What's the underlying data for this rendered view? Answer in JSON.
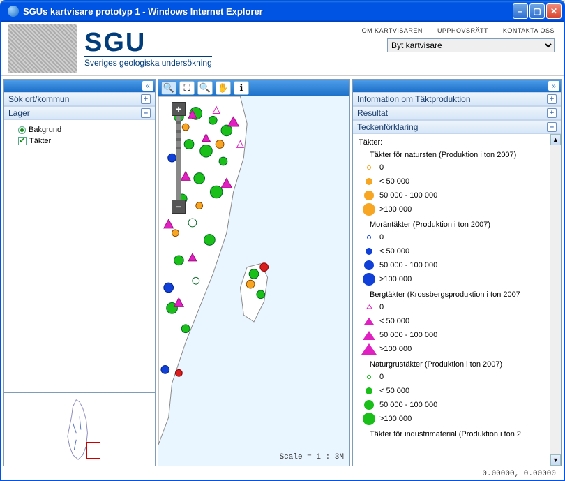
{
  "window": {
    "title": "SGUs kartvisare prototyp 1 - Windows Internet Explorer"
  },
  "logo": {
    "main": "SGU",
    "sub": "Sveriges geologiska undersökning"
  },
  "header_links": {
    "about": "OM KARTVISAREN",
    "copyright": "UPPHOVSRÄTT",
    "contact": "KONTAKTA OSS"
  },
  "selector": {
    "selected": "Byt kartvisare"
  },
  "left": {
    "search_title": "Sök ort/kommun",
    "layers_title": "Lager",
    "layers": [
      {
        "type": "radio",
        "checked": true,
        "label": "Bakgrund"
      },
      {
        "type": "check",
        "checked": true,
        "label": "Täkter"
      }
    ]
  },
  "map": {
    "scale": "Scale = 1 : 3M"
  },
  "right": {
    "info_title": "Information om Täktproduktion",
    "result_title": "Resultat",
    "legend_title": "Teckenförklaring",
    "legend_header": "Täkter:",
    "groups": [
      {
        "title": "Täkter för natursten (Produktion i ton 2007)",
        "shape": "circle",
        "fill_base": "#f6a623",
        "items": [
          {
            "label": "0",
            "size": 6,
            "fill": "none"
          },
          {
            "label": "< 50 000",
            "size": 10,
            "fill": "#f6a623"
          },
          {
            "label": "50 000 - 100 000",
            "size": 14,
            "fill": "#f6a623"
          },
          {
            "label": ">100 000",
            "size": 18,
            "fill": "#f6a623"
          }
        ]
      },
      {
        "title": "Moräntäkter (Produktion i ton 2007)",
        "shape": "circle",
        "fill_base": "#1040d8",
        "items": [
          {
            "label": "0",
            "size": 6,
            "fill": "none"
          },
          {
            "label": "< 50 000",
            "size": 10,
            "fill": "#1040d8"
          },
          {
            "label": "50 000 - 100 000",
            "size": 14,
            "fill": "#1040d8"
          },
          {
            "label": ">100 000",
            "size": 18,
            "fill": "#1040d8"
          }
        ]
      },
      {
        "title": "Bergtäkter (Krossbergsproduktion i ton 2007",
        "shape": "triangle",
        "fill_base": "#e020c0",
        "items": [
          {
            "label": "0",
            "size": 6,
            "fill": "none"
          },
          {
            "label": "< 50 000",
            "size": 10,
            "fill": "#e020c0"
          },
          {
            "label": "50 000 - 100 000",
            "size": 13,
            "fill": "#e020c0"
          },
          {
            "label": ">100 000",
            "size": 16,
            "fill": "#e020c0"
          }
        ]
      },
      {
        "title": "Naturgrustäkter (Produktion i ton 2007)",
        "shape": "circle",
        "fill_base": "#1abf1a",
        "items": [
          {
            "label": "0",
            "size": 6,
            "fill": "none"
          },
          {
            "label": "< 50 000",
            "size": 10,
            "fill": "#1abf1a"
          },
          {
            "label": "50 000 - 100 000",
            "size": 14,
            "fill": "#1abf1a"
          },
          {
            "label": ">100 000",
            "size": 18,
            "fill": "#1abf1a"
          }
        ]
      },
      {
        "title": "Täkter för industrimaterial (Produktion i ton 2",
        "shape": "circle",
        "fill_base": "#888",
        "items": []
      }
    ]
  },
  "footer": {
    "coords": "0.00000, 0.00000"
  }
}
